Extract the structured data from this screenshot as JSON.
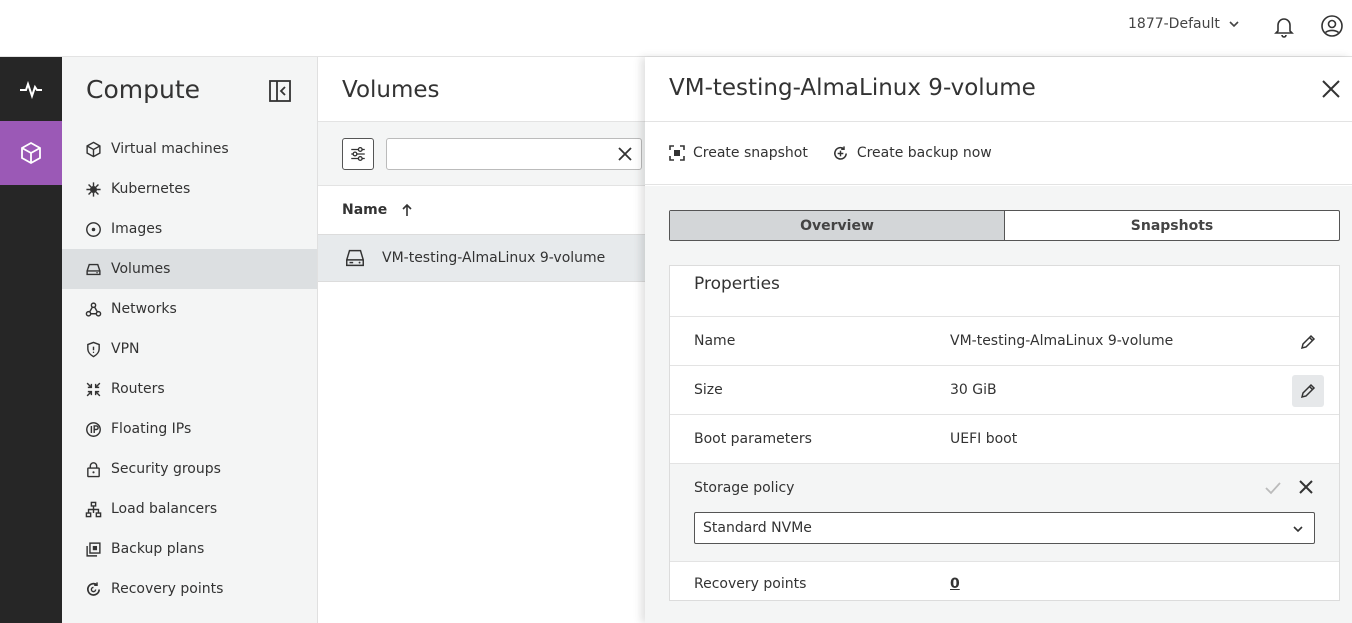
{
  "topbar": {
    "project": "1877-Default",
    "icons": {
      "project_chevron": "chevron-down-icon",
      "notifications": "bell-icon",
      "account": "user-circle-icon"
    }
  },
  "rail": {
    "items": [
      {
        "icon": "pulse-icon"
      },
      {
        "icon": "cube-icon"
      }
    ]
  },
  "nav": {
    "title": "Compute",
    "items": [
      {
        "label": "Virtual machines",
        "icon": "cube-outline-icon"
      },
      {
        "label": "Kubernetes",
        "icon": "helm-icon"
      },
      {
        "label": "Images",
        "icon": "disc-icon"
      },
      {
        "label": "Volumes",
        "icon": "drive-icon"
      },
      {
        "label": "Networks",
        "icon": "network-icon"
      },
      {
        "label": "VPN",
        "icon": "shield-icon"
      },
      {
        "label": "Routers",
        "icon": "router-icon"
      },
      {
        "label": "Floating IPs",
        "icon": "floating-ip-icon"
      },
      {
        "label": "Security groups",
        "icon": "lock-icon"
      },
      {
        "label": "Load balancers",
        "icon": "load-balancer-icon"
      },
      {
        "label": "Backup plans",
        "icon": "copy-icon"
      },
      {
        "label": "Recovery points",
        "icon": "recovery-icon"
      }
    ]
  },
  "list": {
    "title": "Volumes",
    "search_value": "",
    "column_name": "Name",
    "rows": [
      {
        "name": "VM-testing-AlmaLinux 9-volume"
      }
    ]
  },
  "drawer": {
    "title": "VM-testing-AlmaLinux 9-volume",
    "actions": {
      "snapshot": "Create snapshot",
      "backup": "Create backup now"
    },
    "tabs": [
      {
        "label": "Overview"
      },
      {
        "label": "Snapshots"
      }
    ],
    "properties": {
      "title": "Properties",
      "name_label": "Name",
      "name_value": "VM-testing-AlmaLinux 9-volume",
      "size_label": "Size",
      "size_value": "30 GiB",
      "boot_label": "Boot parameters",
      "boot_value": "UEFI boot",
      "policy_label": "Storage policy",
      "policy_value": "Standard NVMe",
      "recovery_label": "Recovery points",
      "recovery_value": "0"
    }
  },
  "colors": {
    "accent": "#9b59b6",
    "rail": "#262626",
    "link": "#2a6ebb"
  }
}
